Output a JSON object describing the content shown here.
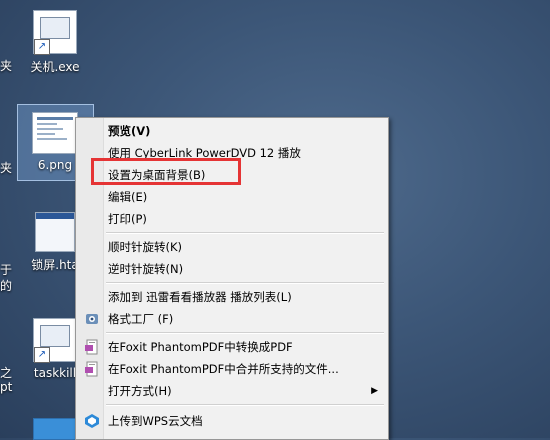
{
  "desktop": {
    "shutdown_label": "关机.exe",
    "image_label": "6.png",
    "lockscreen_label": "锁屏.hta",
    "taskkill_label": "taskkill",
    "edge_chars": [
      "夹",
      "夹",
      "于",
      "的",
      "之",
      "pt"
    ]
  },
  "menu": {
    "items": [
      {
        "label": "预览(V)",
        "bold": true
      },
      {
        "label": "使用 CyberLink PowerDVD 12 播放"
      },
      {
        "label": "设置为桌面背景(B)"
      },
      {
        "label": "编辑(E)"
      },
      {
        "label": "打印(P)"
      },
      {
        "label": "顺时针旋转(K)"
      },
      {
        "label": "逆时针旋转(N)"
      },
      {
        "label": "添加到 迅雷看看播放器 播放列表(L)"
      },
      {
        "label": "格式工厂 (F)"
      },
      {
        "label": "在Foxit PhantomPDF中转换成PDF"
      },
      {
        "label": "在Foxit PhantomPDF中合并所支持的文件..."
      },
      {
        "label": "打开方式(H)"
      },
      {
        "label": "上传到WPS云文档"
      }
    ]
  },
  "colors": {
    "highlight_box": "#e53435"
  }
}
